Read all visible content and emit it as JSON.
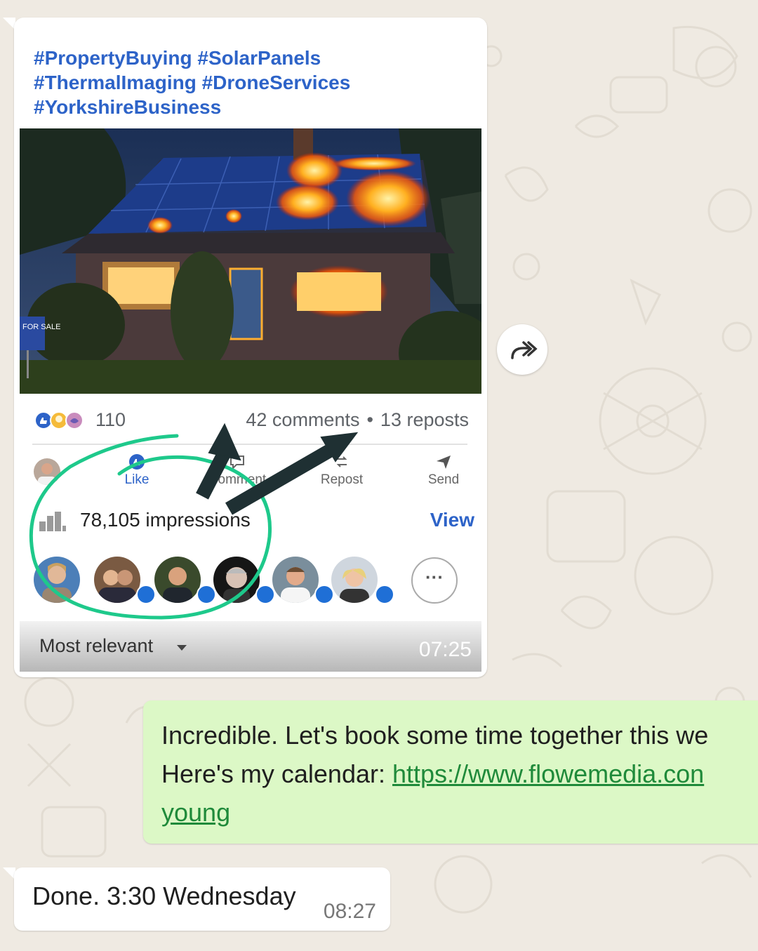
{
  "post": {
    "hashtags": [
      "#PropertyBuying #SolarPanels",
      "#ThermalImaging #DroneServices",
      "#YorkshireBusiness"
    ],
    "photo_desc_icon": "house-thermal-photo",
    "sign_text": "FOR SALE",
    "reaction_count": "110",
    "comments": "42 comments",
    "separator": "•",
    "reposts": "13 reposts",
    "actions": {
      "like": "Like",
      "comment": "Comment",
      "repost": "Repost",
      "send": "Send"
    },
    "impressions": "78,105 impressions",
    "view": "View",
    "more": "···",
    "sort": "Most relevant",
    "time": "07:25"
  },
  "outgoing": {
    "line1": "Incredible. Let's book some time together this we",
    "line2_prefix": "Here's my calendar: ",
    "link1": "https://www.flowemedia.con",
    "link2": "young"
  },
  "reply": {
    "text": "Done. 3:30 Wednesday",
    "time": "08:27"
  },
  "colors": {
    "chat_bg": "#efeae2",
    "link_blue": "#2d63c8",
    "outgoing_bg": "#dcf8c6",
    "highlight_green": "#1ec98b",
    "arrow_dark": "#1f3033"
  },
  "icons": [
    "forward-icon",
    "like-icon",
    "send-icon",
    "repost-icon",
    "impressions-chart-icon",
    "caret-down-icon"
  ]
}
